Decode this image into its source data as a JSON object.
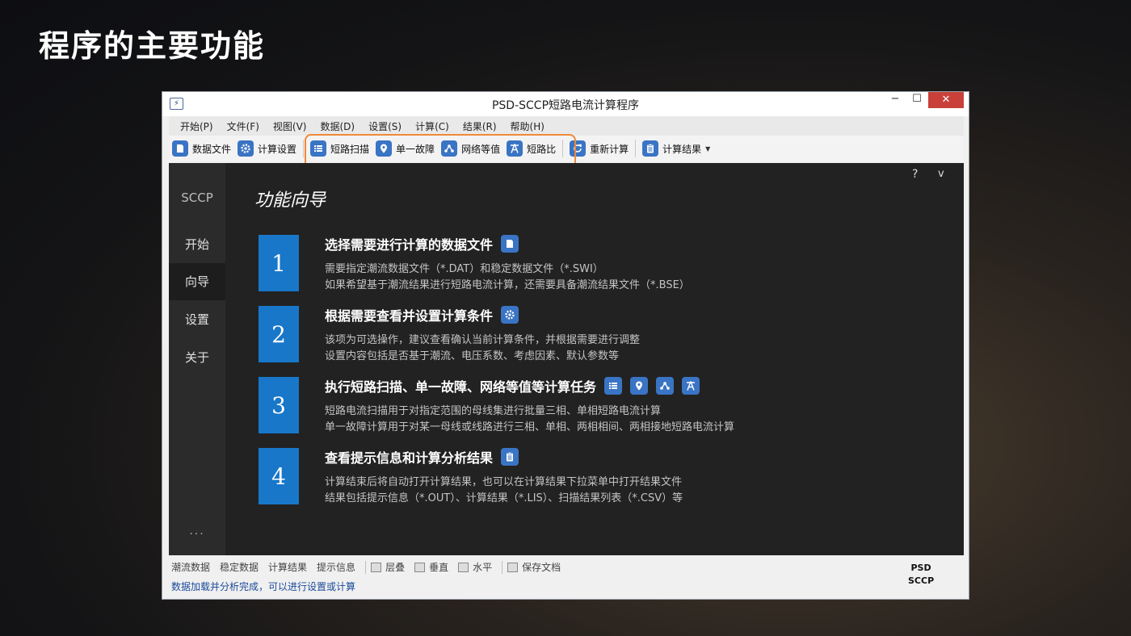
{
  "slide": {
    "title": "程序的主要功能"
  },
  "window": {
    "title": "PSD-SCCP短路电流计算程序",
    "min": "−",
    "max": "☐",
    "close": "✕"
  },
  "menu": [
    "开始(P)",
    "文件(F)",
    "视图(V)",
    "数据(D)",
    "设置(S)",
    "计算(C)",
    "结果(R)",
    "帮助(H)"
  ],
  "toolbar": {
    "data_file": "数据文件",
    "calc_settings": "计算设置",
    "short_scan": "短路扫描",
    "single_fault": "单一故障",
    "network_equiv": "网络等值",
    "short_ratio": "短路比",
    "recalc": "重新计算",
    "calc_results": "计算结果"
  },
  "sidebar": {
    "app": "SCCP",
    "items": [
      "开始",
      "向导",
      "设置",
      "关于"
    ],
    "more": "...",
    "active_index": 1
  },
  "help": {
    "question": "?",
    "collapse": "v"
  },
  "guide": {
    "heading": "功能向导",
    "steps": [
      {
        "num": "1",
        "title": "选择需要进行计算的数据文件",
        "lines": [
          "需要指定潮流数据文件（*.DAT）和稳定数据文件（*.SWI）",
          "如果希望基于潮流结果进行短路电流计算，还需要具备潮流结果文件（*.BSE）"
        ]
      },
      {
        "num": "2",
        "title": "根据需要查看并设置计算条件",
        "lines": [
          "该项为可选操作，建议查看确认当前计算条件，并根据需要进行调整",
          "设置内容包括是否基于潮流、电压系数、考虑因素、默认参数等"
        ]
      },
      {
        "num": "3",
        "title": "执行短路扫描、单一故障、网络等值等计算任务",
        "lines": [
          "短路电流扫描用于对指定范围的母线集进行批量三相、单相短路电流计算",
          "单一故障计算用于对某一母线或线路进行三相、单相、两相相间、两相接地短路电流计算"
        ]
      },
      {
        "num": "4",
        "title": "查看提示信息和计算分析结果",
        "lines": [
          "计算结束后将自动打开计算结果，也可以在计算结果下拉菜单中打开结果文件",
          "结果包括提示信息（*.OUT）、计算结果（*.LIS）、扫描结果列表（*.CSV）等"
        ]
      }
    ]
  },
  "status": {
    "tabs": [
      "潮流数据",
      "稳定数据",
      "计算结果",
      "提示信息"
    ],
    "views": [
      "层叠",
      "垂直",
      "水平"
    ],
    "save": "保存文档",
    "message": "数据加载并分析完成，可以进行设置或计算",
    "brand_line1": "PSD",
    "brand_line2": "SCCP"
  },
  "colors": {
    "accent": "#1877c9",
    "icon_bg": "#3a74c4",
    "highlight": "#f08a3a",
    "close": "#c9403a"
  }
}
